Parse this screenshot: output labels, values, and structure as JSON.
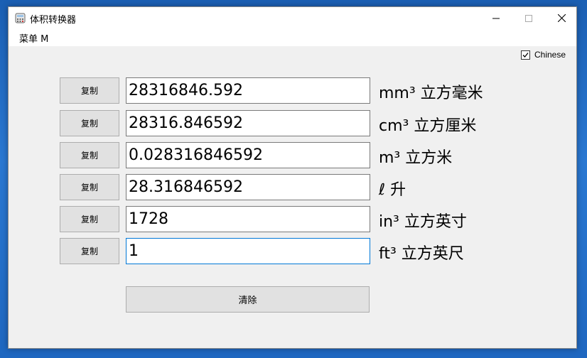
{
  "window": {
    "title": "体积转换器",
    "controls": {
      "minimize": "─",
      "maximize": "☐",
      "close": "✕"
    }
  },
  "menu": {
    "items": [
      {
        "label": "菜单 M"
      }
    ]
  },
  "language_toggle": {
    "label": "Chinese",
    "checked": true
  },
  "rows": [
    {
      "copy_label": "复制",
      "value": "28316846.592",
      "unit": "mm³ 立方毫米"
    },
    {
      "copy_label": "复制",
      "value": "28316.846592",
      "unit": "cm³ 立方厘米"
    },
    {
      "copy_label": "复制",
      "value": "0.028316846592",
      "unit": "m³ 立方米"
    },
    {
      "copy_label": "复制",
      "value": "28.316846592",
      "unit": "ℓ 升"
    },
    {
      "copy_label": "复制",
      "value": "1728",
      "unit": "in³ 立方英寸"
    },
    {
      "copy_label": "复制",
      "value": "1",
      "unit": "ft³ 立方英尺"
    }
  ],
  "clear_button": {
    "label": "清除"
  }
}
